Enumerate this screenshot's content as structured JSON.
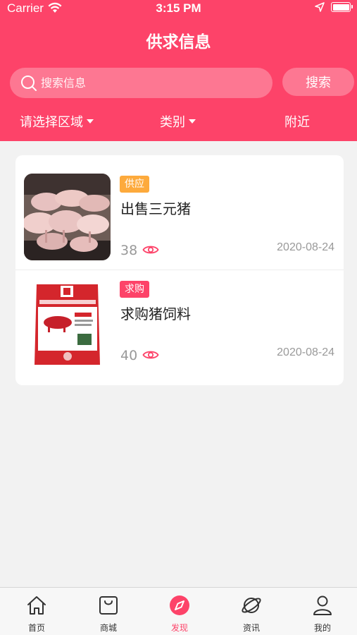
{
  "status_bar": {
    "carrier": "Carrier",
    "time": "3:15 PM"
  },
  "header": {
    "title": "供求信息"
  },
  "search": {
    "placeholder": "搜索信息",
    "button_label": "搜索"
  },
  "filters": {
    "region": "请选择区域",
    "category": "类别",
    "nearby": "附近"
  },
  "items": [
    {
      "tag": "供应",
      "title": "出售三元猪",
      "views": "38",
      "date": "2020-08-24",
      "image": "pigs-photo"
    },
    {
      "tag": "求购",
      "title": "求购猪饲料",
      "views": "40",
      "date": "2020-08-24",
      "image": "pig-feed-bag"
    }
  ],
  "tabbar": {
    "tabs": [
      {
        "label": "首页",
        "icon": "home-icon"
      },
      {
        "label": "商城",
        "icon": "shopping-bag-icon"
      },
      {
        "label": "发现",
        "icon": "compass-icon",
        "active": true
      },
      {
        "label": "资讯",
        "icon": "planet-icon"
      },
      {
        "label": "我的",
        "icon": "user-icon"
      }
    ]
  },
  "colors": {
    "primary": "#fd4369",
    "supply_tag": "#fdaa3c",
    "demand_tag": "#fd4369",
    "background": "#f2f2f2"
  }
}
